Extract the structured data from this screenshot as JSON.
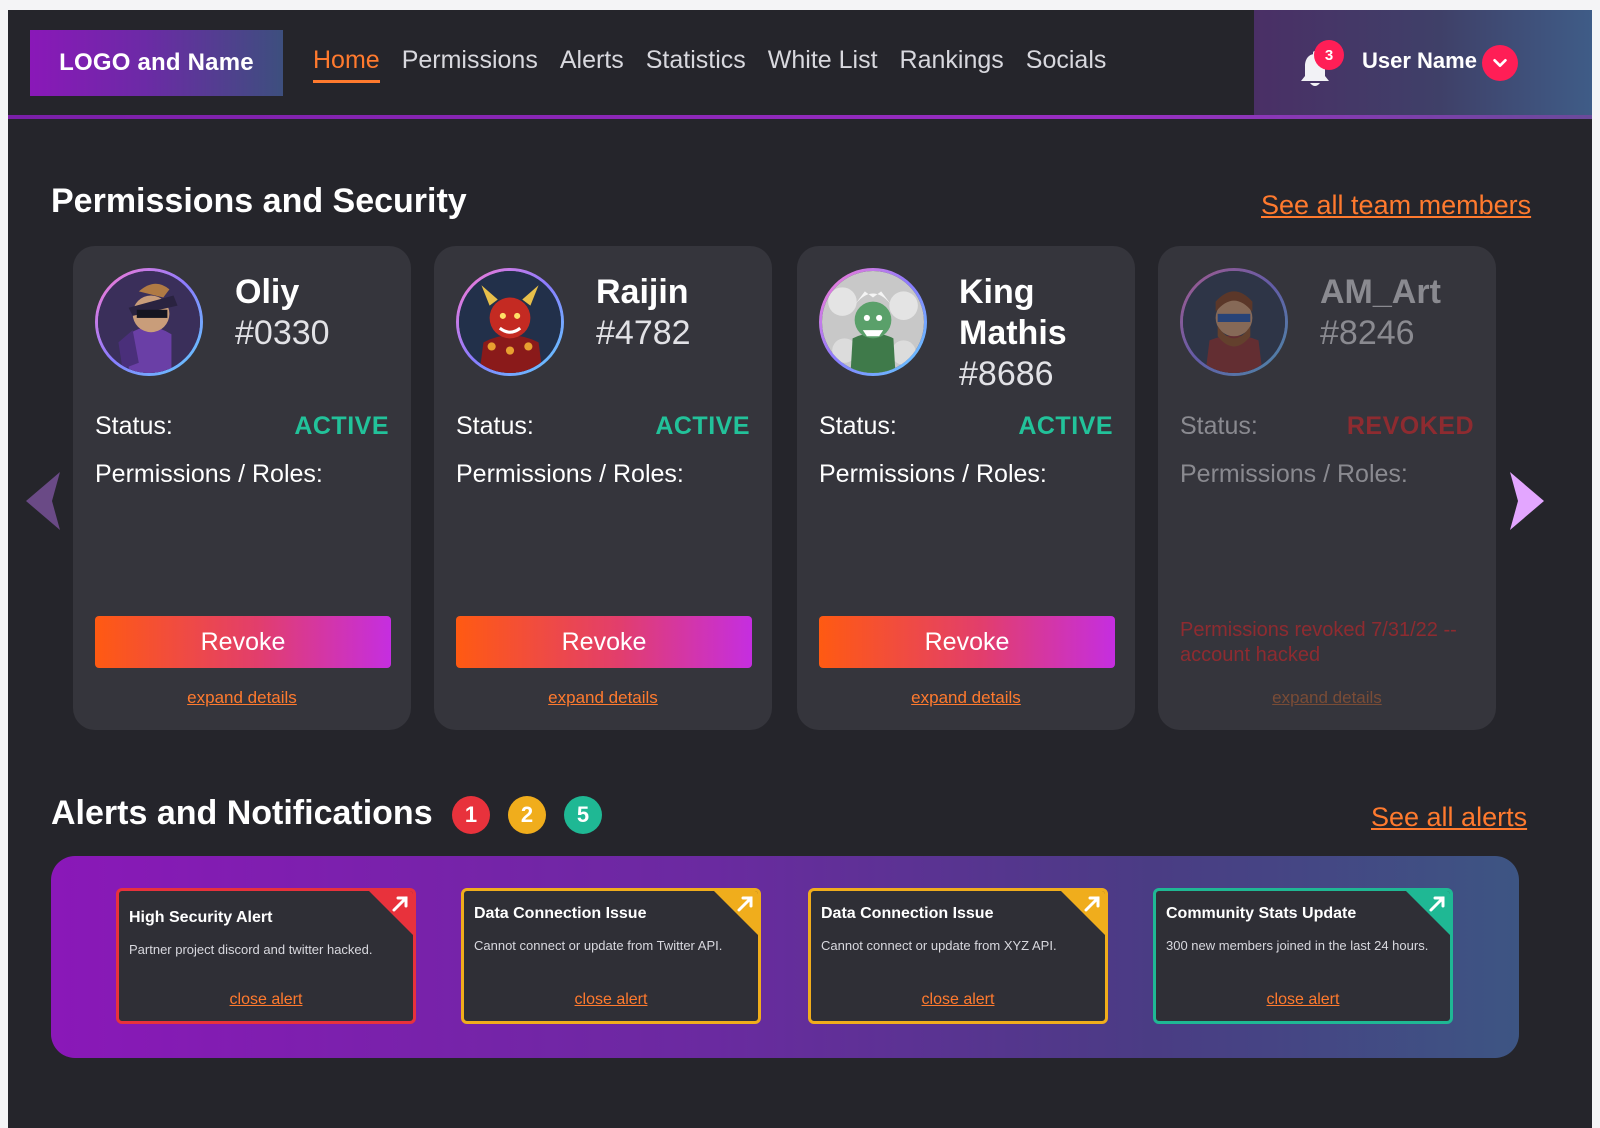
{
  "brand": {
    "logo_text": "LOGO and Name"
  },
  "nav": {
    "links": [
      "Home",
      "Permissions",
      "Alerts",
      "Statistics",
      "White List",
      "Rankings",
      "Socials"
    ],
    "active": "Home"
  },
  "user": {
    "name": "User Name",
    "notification_count": "3",
    "icons": {
      "bell": "bell-icon",
      "toggle": "chevron-down-icon"
    }
  },
  "permissions_section": {
    "title": "Permissions and Security",
    "see_all_label": "See all team members",
    "status_label": "Status:",
    "roles_label": "Permissions / Roles:",
    "revoke_label": "Revoke",
    "expand_label": "expand details",
    "members": [
      {
        "name": "Oliy",
        "tag": "#0330",
        "status": "ACTIVE",
        "status_color": "#22c29a"
      },
      {
        "name": "Raijin",
        "tag": "#4782",
        "status": "ACTIVE",
        "status_color": "#22c29a"
      },
      {
        "name": "King Mathis",
        "tag": "#8686",
        "status": "ACTIVE",
        "status_color": "#22c29a"
      },
      {
        "name": "AM_Art",
        "tag": "#8246",
        "status": "REVOKED",
        "status_color": "#8e2b30",
        "revoked_note": "Permissions revoked 7/31/22 -- account hacked"
      }
    ]
  },
  "alerts_section": {
    "title": "Alerts and Notifications",
    "see_all_label": "See all alerts",
    "counts": [
      {
        "value": "1",
        "color": "#e8323c"
      },
      {
        "value": "2",
        "color": "#f0ad1c"
      },
      {
        "value": "5",
        "color": "#1fb894"
      }
    ],
    "close_label": "close alert",
    "alerts": [
      {
        "title": "High Security Alert",
        "body": "Partner project discord and twitter hacked.",
        "color": "#e8323c"
      },
      {
        "title": "Data Connection Issue",
        "body": "Cannot connect or update from Twitter API.",
        "color": "#f0ad1c"
      },
      {
        "title": "Data Connection Issue",
        "body": "Cannot connect or update from XYZ API.",
        "color": "#f0ad1c"
      },
      {
        "title": "Community Stats Update",
        "body": "300 new members joined in the last 24 hours.",
        "color": "#1fb894"
      }
    ]
  },
  "colors": {
    "accent": "#ff7a2e",
    "background": "#25252b",
    "card": "#35353c",
    "notification": "#ff1e56"
  }
}
